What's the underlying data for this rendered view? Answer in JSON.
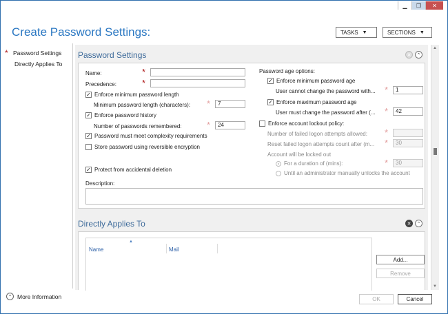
{
  "window": {
    "controls": {
      "minimize": "▁",
      "restore": "❐",
      "close": "✕"
    }
  },
  "header": {
    "title": "Create Password Settings:",
    "tasks_label": "TASKS",
    "sections_label": "SECTIONS"
  },
  "nav": {
    "items": [
      {
        "label": "Password Settings",
        "required": true
      },
      {
        "label": "Directly Applies To",
        "required": false
      }
    ]
  },
  "password_settings": {
    "heading": "Password Settings",
    "name_label": "Name:",
    "name_value": "",
    "precedence_label": "Precedence:",
    "precedence_value": "",
    "enforce_min_length_label": "Enforce minimum password length",
    "enforce_min_length_checked": true,
    "min_length_label": "Minimum password length (characters):",
    "min_length_value": "7",
    "enforce_history_label": "Enforce password history",
    "enforce_history_checked": true,
    "history_label": "Number of passwords remembered:",
    "history_value": "24",
    "complexity_label": "Password must meet complexity requirements",
    "complexity_checked": true,
    "reversible_label": "Store password using reversible encryption",
    "reversible_checked": false,
    "protect_label": "Protect from accidental deletion",
    "protect_checked": true,
    "description_label": "Description:",
    "description_value": "",
    "age_options_label": "Password age options:",
    "enforce_min_age_label": "Enforce minimum password age",
    "enforce_min_age_checked": true,
    "min_age_sub_label": "User cannot change the password with...",
    "min_age_value": "1",
    "enforce_max_age_label": "Enforce maximum password age",
    "enforce_max_age_checked": true,
    "max_age_sub_label": "User must change the password after (...",
    "max_age_value": "42",
    "lockout_label": "Enforce account lockout policy:",
    "lockout_checked": false,
    "failed_attempts_label": "Number of failed logon attempts allowed:",
    "failed_attempts_value": "",
    "reset_count_label": "Reset failed logon attempts count after (m...",
    "reset_count_value": "30",
    "locked_out_label": "Account will be locked out",
    "duration_label": "For a duration of (mins):",
    "duration_value": "30",
    "until_admin_label": "Until an administrator manually unlocks the account"
  },
  "applies_to": {
    "heading": "Directly Applies To",
    "columns": [
      "Name",
      "Mail"
    ],
    "add_label": "Add...",
    "remove_label": "Remove"
  },
  "footer": {
    "more_info_label": "More Information",
    "ok_label": "OK",
    "cancel_label": "Cancel"
  }
}
